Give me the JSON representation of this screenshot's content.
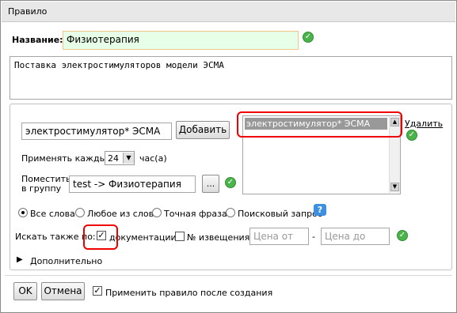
{
  "dialog": {
    "title": "Правило",
    "name_label": "Название:",
    "name_value": "Физиотерапия",
    "description": "Поставка электростимуляторов модели ЭСМА"
  },
  "keywords": {
    "input_value": "электростимулятор* ЭСМА",
    "add_label": "Добавить",
    "apply_every_label": "Применять каждые",
    "hours_value": "24",
    "hours_unit": "час(а)",
    "group_label_line1": "Поместить",
    "group_label_line2": "в группу",
    "group_value": "test -> Физиотерапия",
    "browse_label": "...",
    "list_items": [
      "электростимулятор* ЭСМА"
    ],
    "delete_label": "Удалить"
  },
  "match_mode": {
    "options": [
      "Все слова",
      "Любое из слов",
      "Точная фраза",
      "Поисковый запрос"
    ],
    "selected": "Все слова"
  },
  "search_also": {
    "label": "Искать также по:",
    "documentation_label": "документации",
    "documentation_checked": true,
    "notice_label": "№ извещения",
    "notice_checked": false,
    "price_from_placeholder": "Цена от",
    "price_sep": "-",
    "price_to_placeholder": "Цена до"
  },
  "advanced_label": "Дополнительно",
  "footer": {
    "ok_label": "OK",
    "cancel_label": "Отмена",
    "apply_after_label": "Применить правило после создания",
    "apply_after_checked": true
  },
  "colors": {
    "highlight": "#e00000",
    "name_field_bg": "#e6ffe6",
    "name_field_border": "#f2c58a",
    "ok_icon": "#4bb34b",
    "help_icon": "#3d8fe0",
    "list_selection": "#999999"
  }
}
